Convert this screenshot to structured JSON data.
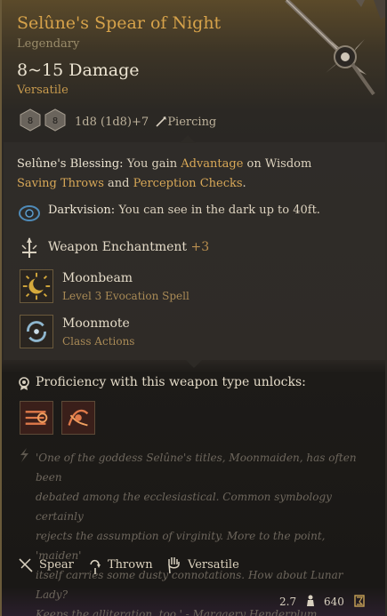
{
  "item": {
    "name": "Selûne's Spear of Night",
    "rarity": "Legendary",
    "damage": "8~15 Damage",
    "property": "Versatile",
    "dice_text": "1d8 (1d8)+7",
    "damage_type": "Piercing",
    "die_values": [
      "8",
      "8"
    ]
  },
  "blessing": {
    "name": "Selûne's Blessing:",
    "text_1": "You gain",
    "advantage": "Advantage",
    "text_2": "on Wisdom",
    "saving_throws": "Saving Throws",
    "text_3": "and",
    "perception": "Perception Checks",
    "text_4": "."
  },
  "darkvision": {
    "name": "Darkvision:",
    "text": "You can see in the dark up to 40ft."
  },
  "enchantment": {
    "label": "Weapon Enchantment",
    "value": "+3"
  },
  "spells": [
    {
      "name": "Moonbeam",
      "sub": "Level 3 Evocation Spell",
      "icon": "moonbeam-icon"
    },
    {
      "name": "Moonmote",
      "sub": "Class Actions",
      "icon": "moonmote-icon"
    }
  ],
  "proficiency": {
    "label": "Proficiency with this weapon type unlocks:"
  },
  "quote": {
    "line_1": "'One of the goddess Selûne's titles, Moonmaiden, has often been",
    "line_2": "debated among the ecclesiastical. Common symbology certainly",
    "line_3": "rejects the assumption of virginity. More to the point, 'maiden'",
    "line_4": "itself carries some dusty connotations. How about Lunar Lady?",
    "line_5": "Keeps the alliteration, too.' - Margaery Henderplum"
  },
  "tags": [
    "Spear",
    "Thrown",
    "Versatile"
  ],
  "footer": {
    "weight": "2.7",
    "price": "640"
  },
  "colors": {
    "title": "#d6a24a",
    "gold_text": "#d8a857",
    "body_text": "#ddd3bf",
    "quote_text": "#6d665c"
  }
}
